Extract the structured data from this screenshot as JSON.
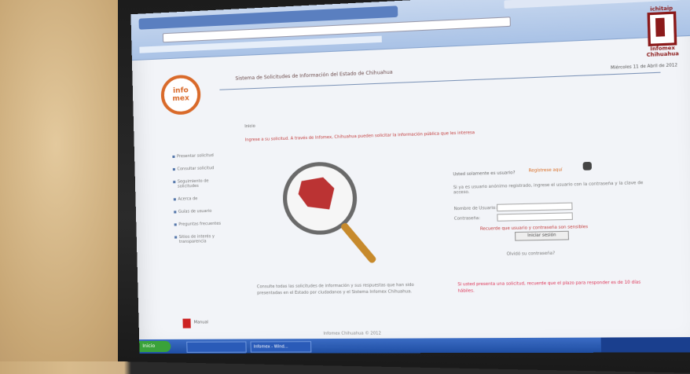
{
  "header": {
    "title": "Sistema de Solicitudes de Información del Estado de Chihuahua",
    "date": "Miércoles 11 de Abril de 2012"
  },
  "logos": {
    "left_top": "info",
    "left_bottom": "mex",
    "right_top": "ichitaip",
    "right_bottom": "Infomex Chihuahua"
  },
  "main": {
    "breadcrumb": "Inicio",
    "intro": "Ingrese a su solicitud. A través de Infomex, Chihuahua pueden solicitar la información pública que les interesa",
    "login_label": "Usted solamente es usuario?",
    "login_link": "Regístrese aquí",
    "help": "Si ya es usuario anónimo registrado, ingrese el usuario con la contraseña y la clave de acceso.",
    "user_label": "Nombre de Usuario:",
    "pass_label": "Contraseña:",
    "warning": "Recuerde que usuario y contraseña son sensibles",
    "submit_label": "Iniciar sesión",
    "forgot": "Olvidó su contraseña?"
  },
  "sidebar": {
    "items": [
      "Presentar solicitud",
      "Consultar solicitud",
      "Seguimiento de solicitudes",
      "Acerca de",
      "Guías de usuario",
      "Preguntas frecuentes",
      "Sitios de interés y transparencia"
    ]
  },
  "notes": {
    "left": "Consulte todas las solicitudes de información y sus respuestas que han sido presentadas en el Estado por ciudadanos y el Sistema Infomex Chihuahua.",
    "right": "Si usted presenta una solicitud, recuerde que el plazo para responder es de 10 días hábiles."
  },
  "pdf_label": "Manual",
  "footer": "Infomex Chihuahua © 2012",
  "taskbar": {
    "start": "Inicio",
    "tasks": [
      "",
      "Infomex - Wind..."
    ]
  },
  "colors": {
    "accent": "#d96a2a",
    "brand": "#8b1a1a"
  }
}
